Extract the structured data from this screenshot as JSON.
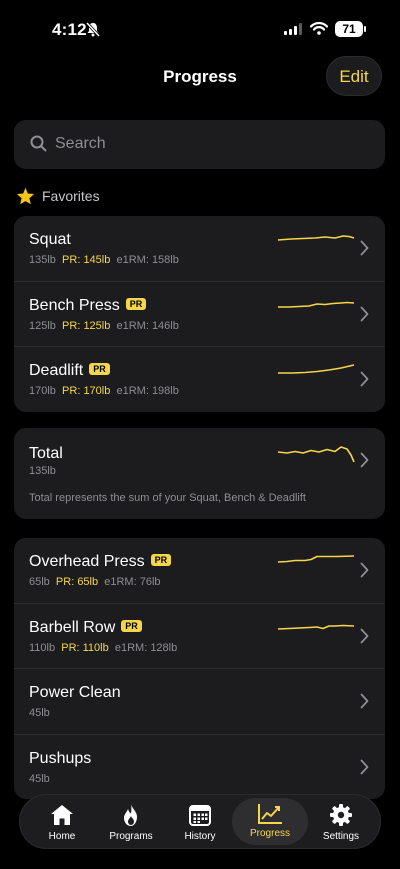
{
  "status": {
    "time": "4:12",
    "battery": "71"
  },
  "header": {
    "title": "Progress",
    "edit": "Edit"
  },
  "search": {
    "placeholder": "Search"
  },
  "favorites": {
    "title": "Favorites",
    "items": [
      {
        "name": "Squat",
        "weight": "135lb",
        "pr_text": "PR: 145lb",
        "e1rm": "e1RM: 158lb",
        "pr_badge": ""
      },
      {
        "name": "Bench Press",
        "weight": "125lb",
        "pr_text": "PR: 125lb",
        "e1rm": "e1RM: 146lb",
        "pr_badge": "PR"
      },
      {
        "name": "Deadlift",
        "weight": "170lb",
        "pr_text": "PR: 170lb",
        "e1rm": "e1RM: 198lb",
        "pr_badge": "PR"
      }
    ]
  },
  "total": {
    "title": "Total",
    "value": "135lb",
    "note": "Total represents the sum of your Squat, Bench & Deadlift"
  },
  "exercises": [
    {
      "name": "Overhead Press",
      "weight": "65lb",
      "pr_text": "PR: 65lb",
      "e1rm": "e1RM: 76lb",
      "pr_badge": "PR"
    },
    {
      "name": "Barbell Row",
      "weight": "110lb",
      "pr_text": "PR: 110lb",
      "e1rm": "e1RM: 128lb",
      "pr_badge": "PR"
    },
    {
      "name": "Power Clean",
      "weight": "45lb"
    },
    {
      "name": "Pushups",
      "weight": "45lb"
    }
  ],
  "tabs": [
    {
      "label": "Home",
      "icon": "home-icon"
    },
    {
      "label": "Programs",
      "icon": "flame-icon"
    },
    {
      "label": "History",
      "icon": "calendar-icon"
    },
    {
      "label": "Progress",
      "icon": "chart-icon",
      "active": true
    },
    {
      "label": "Settings",
      "icon": "gear-icon"
    }
  ],
  "colors": {
    "accent": "#f5d64a",
    "card": "#1c1c1e",
    "background": "#000000"
  }
}
